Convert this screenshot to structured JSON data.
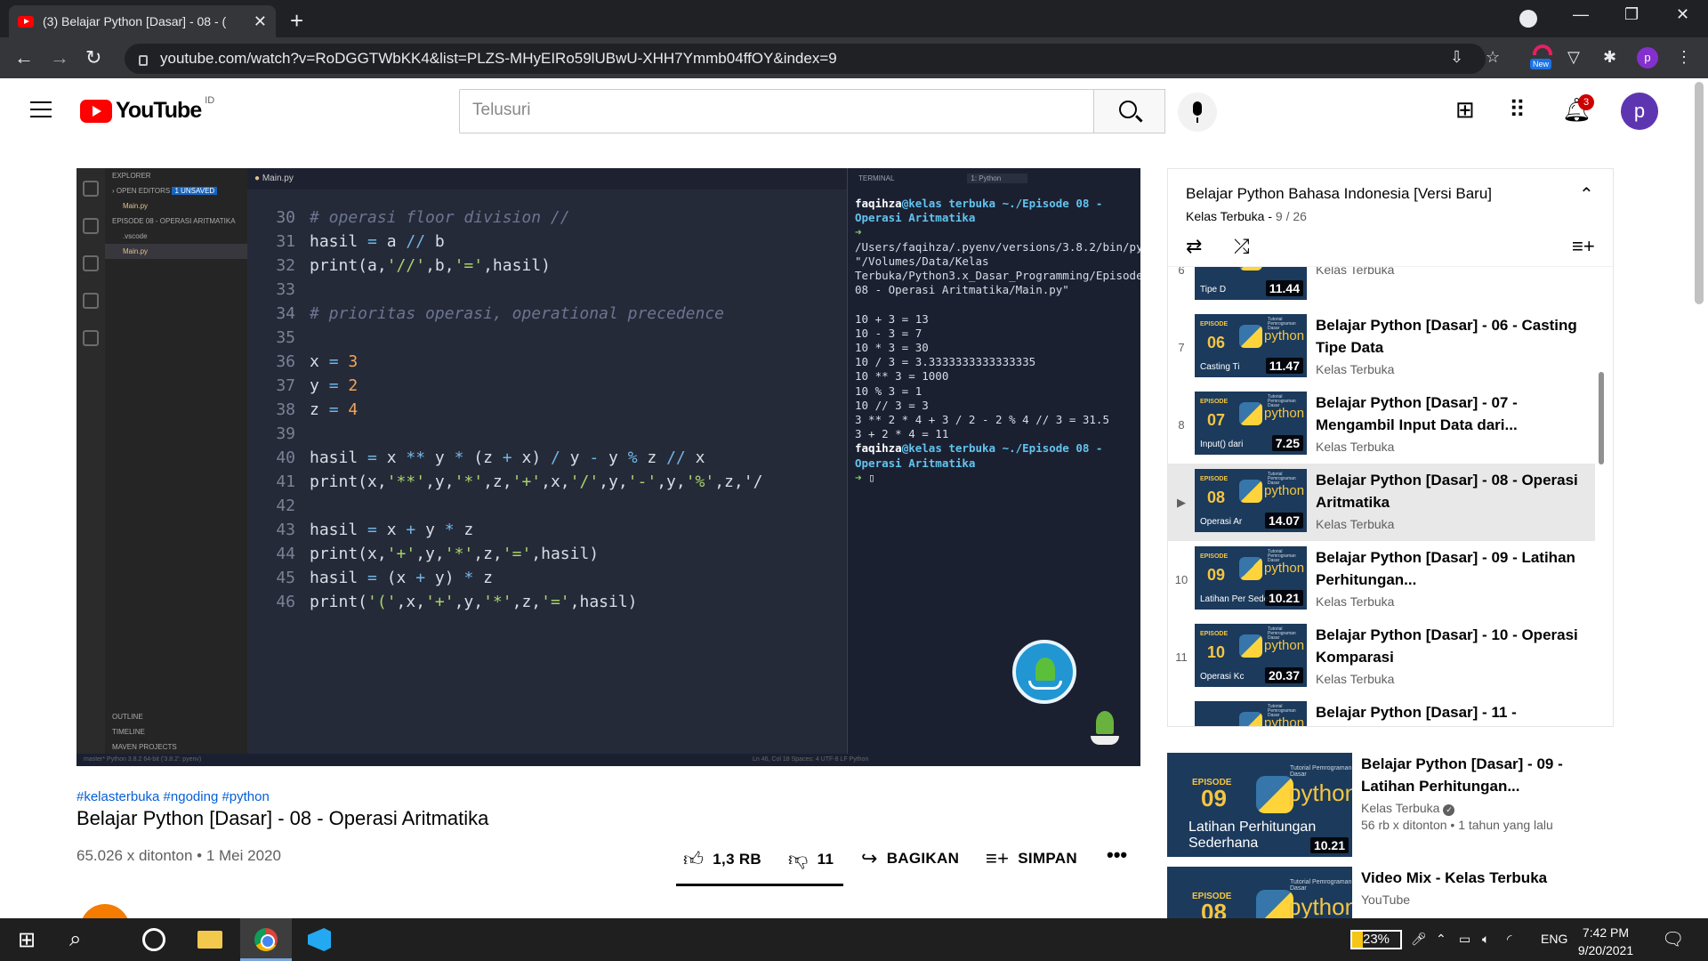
{
  "browser": {
    "tab_title": "(3) Belajar Python [Dasar] - 08 - (",
    "url": "youtube.com/watch?v=RoDGGTWbKK4&list=PLZS-MHyEIRo59lUBwU-XHH7Ymmb04ffOY&index=9",
    "ext_new_badge": "New",
    "profile_letter": "p"
  },
  "youtube": {
    "logo_text": "YouTube",
    "country_code": "ID",
    "search_placeholder": "Telusuri",
    "notification_count": "3",
    "avatar_letter": "p"
  },
  "vscode": {
    "tab_file": "Main.py",
    "explorer_label": "EXPLORER",
    "open_editors": "OPEN EDITORS",
    "unsaved": "1 UNSAVED",
    "open_file": "Main.py",
    "project": "EPISODE 08 - OPERASI ARITMATIKA",
    "folder_vscode": ".vscode",
    "file_main": "Main.py",
    "outline": "OUTLINE",
    "timeline": "TIMELINE",
    "maven": "MAVEN PROJECTS",
    "terminal_label": "TERMINAL",
    "terminal_select": "1: Python",
    "status_left": "master*  Python 3.8.2 64-bit ('3.8.2': pyenv)",
    "status_right": "Ln 46, Col 18   Spaces: 4   UTF-8   LF   Python",
    "code_lines": [
      {
        "n": "30",
        "parts": [
          {
            "c": "cm",
            "t": "# operasi floor division //"
          }
        ]
      },
      {
        "n": "31",
        "parts": [
          {
            "c": "t",
            "t": "hasil "
          },
          {
            "c": "op",
            "t": "="
          },
          {
            "c": "t",
            "t": " a "
          },
          {
            "c": "op",
            "t": "//"
          },
          {
            "c": "t",
            "t": " b"
          }
        ]
      },
      {
        "n": "32",
        "parts": [
          {
            "c": "t",
            "t": "print(a,"
          },
          {
            "c": "s",
            "t": "'//'"
          },
          {
            "c": "t",
            "t": ",b,"
          },
          {
            "c": "s",
            "t": "'='"
          },
          {
            "c": "t",
            "t": ",hasil)"
          }
        ]
      },
      {
        "n": "33",
        "parts": []
      },
      {
        "n": "34",
        "parts": [
          {
            "c": "cm",
            "t": "# prioritas operasi, operational precedence"
          }
        ]
      },
      {
        "n": "35",
        "parts": []
      },
      {
        "n": "36",
        "parts": [
          {
            "c": "t",
            "t": "x "
          },
          {
            "c": "op",
            "t": "="
          },
          {
            "c": "t",
            "t": " "
          },
          {
            "c": "num",
            "t": "3"
          }
        ]
      },
      {
        "n": "37",
        "parts": [
          {
            "c": "t",
            "t": "y "
          },
          {
            "c": "op",
            "t": "="
          },
          {
            "c": "t",
            "t": " "
          },
          {
            "c": "num",
            "t": "2"
          }
        ]
      },
      {
        "n": "38",
        "parts": [
          {
            "c": "t",
            "t": "z "
          },
          {
            "c": "op",
            "t": "="
          },
          {
            "c": "t",
            "t": " "
          },
          {
            "c": "num",
            "t": "4"
          }
        ]
      },
      {
        "n": "39",
        "parts": []
      },
      {
        "n": "40",
        "parts": [
          {
            "c": "t",
            "t": "hasil "
          },
          {
            "c": "op",
            "t": "="
          },
          {
            "c": "t",
            "t": " x "
          },
          {
            "c": "op",
            "t": "**"
          },
          {
            "c": "t",
            "t": " y "
          },
          {
            "c": "op",
            "t": "*"
          },
          {
            "c": "t",
            "t": " (z "
          },
          {
            "c": "op",
            "t": "+"
          },
          {
            "c": "t",
            "t": " x) "
          },
          {
            "c": "op",
            "t": "/"
          },
          {
            "c": "t",
            "t": " y "
          },
          {
            "c": "op",
            "t": "-"
          },
          {
            "c": "t",
            "t": " y "
          },
          {
            "c": "op",
            "t": "%"
          },
          {
            "c": "t",
            "t": " z "
          },
          {
            "c": "op",
            "t": "//"
          },
          {
            "c": "t",
            "t": " x"
          }
        ]
      },
      {
        "n": "41",
        "parts": [
          {
            "c": "t",
            "t": "print(x,"
          },
          {
            "c": "s",
            "t": "'**'"
          },
          {
            "c": "t",
            "t": ",y,"
          },
          {
            "c": "s",
            "t": "'*'"
          },
          {
            "c": "t",
            "t": ",z,"
          },
          {
            "c": "s",
            "t": "'+'"
          },
          {
            "c": "t",
            "t": ",x,"
          },
          {
            "c": "s",
            "t": "'/'"
          },
          {
            "c": "t",
            "t": ",y,"
          },
          {
            "c": "s",
            "t": "'-'"
          },
          {
            "c": "t",
            "t": ",y,"
          },
          {
            "c": "s",
            "t": "'%'"
          },
          {
            "c": "t",
            "t": ",z,'/"
          }
        ]
      },
      {
        "n": "42",
        "parts": []
      },
      {
        "n": "43",
        "parts": [
          {
            "c": "t",
            "t": "hasil "
          },
          {
            "c": "op",
            "t": "="
          },
          {
            "c": "t",
            "t": " x "
          },
          {
            "c": "op",
            "t": "+"
          },
          {
            "c": "t",
            "t": " y "
          },
          {
            "c": "op",
            "t": "*"
          },
          {
            "c": "t",
            "t": " z"
          }
        ]
      },
      {
        "n": "44",
        "parts": [
          {
            "c": "t",
            "t": "print(x,"
          },
          {
            "c": "s",
            "t": "'+'"
          },
          {
            "c": "t",
            "t": ",y,"
          },
          {
            "c": "s",
            "t": "'*'"
          },
          {
            "c": "t",
            "t": ",z,"
          },
          {
            "c": "s",
            "t": "'='"
          },
          {
            "c": "t",
            "t": ",hasil)"
          }
        ]
      },
      {
        "n": "45",
        "parts": [
          {
            "c": "t",
            "t": "hasil "
          },
          {
            "c": "op",
            "t": "="
          },
          {
            "c": "t",
            "t": " (x "
          },
          {
            "c": "op",
            "t": "+"
          },
          {
            "c": "t",
            "t": " y) "
          },
          {
            "c": "op",
            "t": "*"
          },
          {
            "c": "t",
            "t": " z"
          }
        ]
      },
      {
        "n": "46",
        "parts": [
          {
            "c": "t",
            "t": "print("
          },
          {
            "c": "s",
            "t": "'('"
          },
          {
            "c": "t",
            "t": ",x,"
          },
          {
            "c": "s",
            "t": "'+'"
          },
          {
            "c": "t",
            "t": ",y,"
          },
          {
            "c": "s",
            "t": "'*'"
          },
          {
            "c": "t",
            "t": ",z,"
          },
          {
            "c": "s",
            "t": "'='"
          },
          {
            "c": "t",
            "t": ",hasil)"
          }
        ]
      }
    ],
    "terminal_lines": [
      {
        "parts": [
          {
            "c": "u",
            "t": "faqihza"
          },
          {
            "c": "p",
            "t": "@kelas terbuka ~./Episode 08 - Operasi Aritmatika"
          }
        ]
      },
      {
        "parts": [
          {
            "c": "g",
            "t": "➜ "
          },
          {
            "c": "t",
            "t": "/Users/faqihza/.pyenv/versions/3.8.2/bin/python \"/Volumes/Data/Kelas Terbuka/Python3.x_Dasar_Programming/Episode 08 - Operasi Aritmatika/Main.py\""
          }
        ]
      },
      {
        "parts": [
          {
            "c": "t",
            "t": " "
          }
        ]
      },
      {
        "parts": [
          {
            "c": "t",
            "t": "10 + 3 = 13"
          }
        ]
      },
      {
        "parts": [
          {
            "c": "t",
            "t": "10 - 3 = 7"
          }
        ]
      },
      {
        "parts": [
          {
            "c": "t",
            "t": "10 * 3 = 30"
          }
        ]
      },
      {
        "parts": [
          {
            "c": "t",
            "t": "10 / 3 = 3.3333333333333335"
          }
        ]
      },
      {
        "parts": [
          {
            "c": "t",
            "t": "10 ** 3 = 1000"
          }
        ]
      },
      {
        "parts": [
          {
            "c": "t",
            "t": "10 % 3 = 1"
          }
        ]
      },
      {
        "parts": [
          {
            "c": "t",
            "t": "10 // 3 = 3"
          }
        ]
      },
      {
        "parts": [
          {
            "c": "t",
            "t": "3 ** 2 * 4 + 3 / 2 - 2 % 4 // 3 = 31.5"
          }
        ]
      },
      {
        "parts": [
          {
            "c": "t",
            "t": "3 + 2 * 4 = 11"
          }
        ]
      },
      {
        "parts": [
          {
            "c": "u",
            "t": "faqihza"
          },
          {
            "c": "p",
            "t": "@kelas terbuka ~./Episode 08 - Operasi Aritmatika"
          }
        ]
      },
      {
        "parts": [
          {
            "c": "g",
            "t": "➜ "
          },
          {
            "c": "t",
            "t": "▯"
          }
        ]
      }
    ]
  },
  "video": {
    "hashtags": "#kelasterbuka #ngoding #python",
    "title": "Belajar Python [Dasar] - 08 - Operasi Aritmatika",
    "meta": "65.026 x ditonton • 1 Mei 2020",
    "likes": "1,3 RB",
    "dislikes": "11",
    "like_ratio": 0.99,
    "share": "BAGIKAN",
    "save": "SIMPAN",
    "more": "•••"
  },
  "playlist": {
    "title": "Belajar Python Bahasa Indonesia [Versi Baru]",
    "channel": "Kelas Terbuka",
    "position": "9 / 26",
    "items": [
      {
        "idx": "6",
        "ep": "",
        "title": "Tipe Data",
        "channel": "Kelas Terbuka",
        "sub": "Tipe D",
        "dur": "11.44"
      },
      {
        "idx": "7",
        "ep": "06",
        "title": "Belajar Python [Dasar] - 06 - Casting Tipe Data",
        "channel": "Kelas Terbuka",
        "sub": "Casting Ti",
        "dur": "11.47"
      },
      {
        "idx": "8",
        "ep": "07",
        "title": "Belajar Python [Dasar] - 07 - Mengambil Input Data dari...",
        "channel": "Kelas Terbuka",
        "sub": "Input() dari",
        "dur": "7.25"
      },
      {
        "idx": "▶",
        "ep": "08",
        "title": "Belajar Python [Dasar] - 08 - Operasi Aritmatika",
        "channel": "Kelas Terbuka",
        "sub": "Operasi Ar",
        "dur": "14.07"
      },
      {
        "idx": "10",
        "ep": "09",
        "title": "Belajar Python [Dasar] - 09 - Latihan Perhitungan...",
        "channel": "Kelas Terbuka",
        "sub": "Latihan Per Seder",
        "dur": "10.21"
      },
      {
        "idx": "11",
        "ep": "10",
        "title": "Belajar Python [Dasar] - 10 - Operasi Komparasi",
        "channel": "Kelas Terbuka",
        "sub": "Operasi Kc",
        "dur": "20.37"
      },
      {
        "idx": "",
        "ep": "",
        "title": "Belajar Python [Dasar] - 11 -",
        "channel": "",
        "sub": "",
        "dur": ""
      }
    ],
    "thumb_episode_label": "EPISODE",
    "thumb_tutorial": "Tutorial Pemrograman Dasar",
    "thumb_python": "python"
  },
  "related": [
    {
      "ep": "09",
      "title": "Belajar Python [Dasar] - 09 - Latihan Perhitungan...",
      "channel": "Kelas Terbuka",
      "meta": "56 rb x ditonton • 1 tahun yang lalu",
      "sub": "Latihan Perhitungan Sederhana",
      "dur": "10.21"
    },
    {
      "ep": "08",
      "title": "Video Mix - Kelas Terbuka",
      "channel": "YouTube",
      "meta": "",
      "sub": "",
      "dur": ""
    }
  ],
  "taskbar": {
    "battery": "23%",
    "battery_level": 0.23,
    "lang": "ENG",
    "time": "7:42 PM",
    "date": "9/20/2021"
  }
}
